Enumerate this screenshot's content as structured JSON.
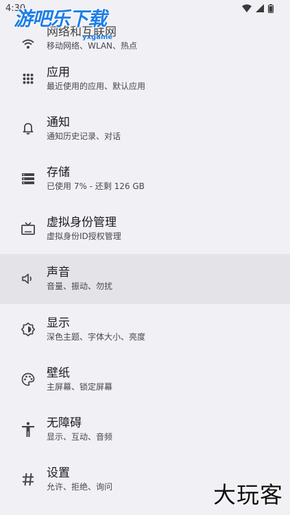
{
  "status_bar": {
    "time": "4:30"
  },
  "watermark": {
    "top_logo": "游吧乐下载",
    "top_sub": "yxgame",
    "bottom_logo": "大玩客"
  },
  "settings": [
    {
      "icon": "wifi-icon",
      "title": "网络和互联网",
      "subtitle": "移动网络、WLAN、热点"
    },
    {
      "icon": "apps-grid-icon",
      "title": "应用",
      "subtitle": "最近使用的应用、默认应用"
    },
    {
      "icon": "bell-icon",
      "title": "通知",
      "subtitle": "通知历史记录、对话"
    },
    {
      "icon": "storage-icon",
      "title": "存储",
      "subtitle": "已使用 7% - 还剩 126 GB"
    },
    {
      "icon": "tv-icon",
      "title": "虚拟身份管理",
      "subtitle": "虚拟身份ID授权管理"
    },
    {
      "icon": "volume-icon",
      "title": "声音",
      "subtitle": "音量、振动、勿扰"
    },
    {
      "icon": "brightness-icon",
      "title": "显示",
      "subtitle": "深色主题、字体大小、亮度"
    },
    {
      "icon": "palette-icon",
      "title": "壁纸",
      "subtitle": "主屏幕、锁定屏幕"
    },
    {
      "icon": "accessibility-icon",
      "title": "无障碍",
      "subtitle": "显示、互动、音频"
    },
    {
      "icon": "hash-icon",
      "title": "设置",
      "subtitle": "允许、拒绝、询问"
    }
  ]
}
